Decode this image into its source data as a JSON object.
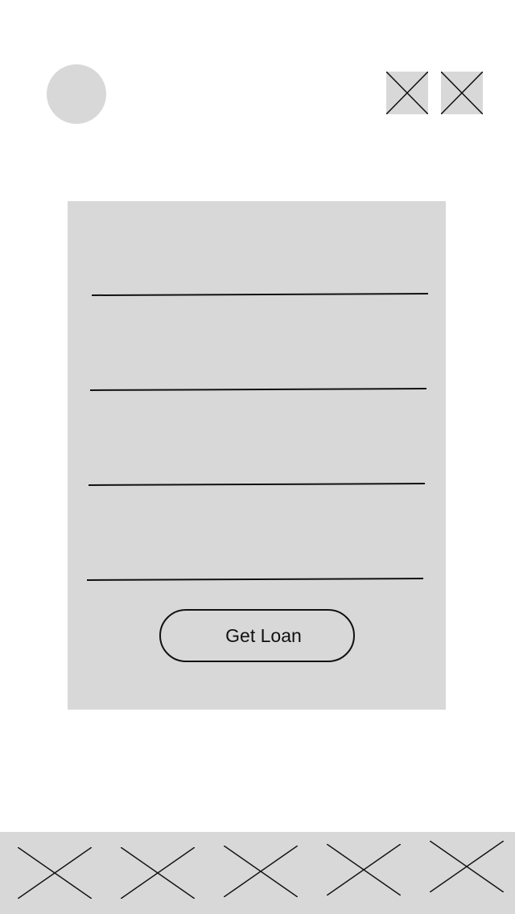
{
  "header": {
    "avatar_icon": "avatar-placeholder",
    "action_icons": [
      "image-placeholder-icon",
      "image-placeholder-icon"
    ]
  },
  "form": {
    "field_count": 4,
    "submit_label": "Get Loan"
  },
  "bottom_nav": {
    "tab_icons": [
      "image-placeholder-icon",
      "image-placeholder-icon",
      "image-placeholder-icon",
      "image-placeholder-icon",
      "image-placeholder-icon"
    ]
  },
  "colors": {
    "placeholder_fill": "#d8d8d8",
    "line": "#111111",
    "background": "#ffffff"
  }
}
